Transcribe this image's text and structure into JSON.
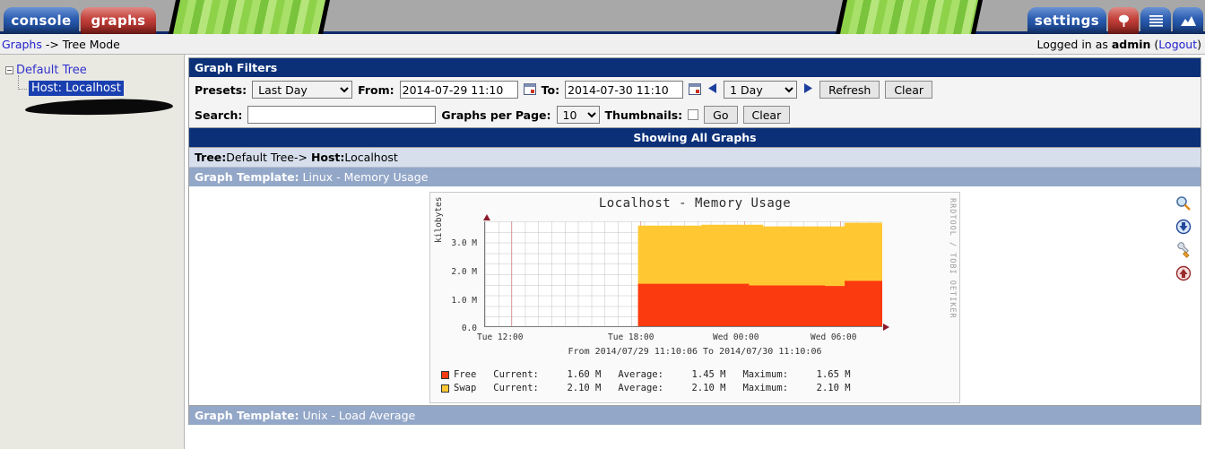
{
  "header": {
    "tabs": [
      {
        "label": "console",
        "name": "tab-console"
      },
      {
        "label": "graphs",
        "name": "tab-graphs"
      },
      {
        "label": "settings",
        "name": "tab-settings"
      }
    ],
    "icon_buttons": [
      "tree-icon",
      "list-icon",
      "graph-view-icon"
    ],
    "colors": {
      "tab_blue": "#2a5cb0",
      "tab_red": "#c4403a",
      "banner_green": "#8ed24a",
      "navy": "#102a6b"
    }
  },
  "breadcrumb": {
    "link": "Graphs",
    "rest": " -> Tree Mode",
    "logged_prefix": "Logged in as ",
    "user": "admin",
    "logout_open": " (",
    "logout": "Logout",
    "logout_close": ")"
  },
  "sidebar": {
    "root_label": "Default Tree",
    "expander_glyph": "−",
    "child_label": "Host: Localhost",
    "redacted_present": true
  },
  "filters": {
    "title": "Graph Filters",
    "presets_label": "Presets:",
    "presets_value": "Last Day",
    "presets_options": [
      "Last Day"
    ],
    "from_label": "From:",
    "from_value": "2014-07-29 11:10",
    "to_label": "To:",
    "to_value": "2014-07-30 11:10",
    "span_value": "1 Day",
    "span_options": [
      "1 Day"
    ],
    "refresh_label": "Refresh",
    "clear_label": "Clear",
    "search_label": "Search:",
    "search_value": "",
    "search_placeholder": "",
    "graphs_per_page_label": "Graphs per Page:",
    "graphs_per_page_value": "10",
    "graphs_per_page_options": [
      "10"
    ],
    "thumbnails_label": "Thumbnails:",
    "thumbnails_checked": false,
    "go_label": "Go",
    "clear2_label": "Clear"
  },
  "results": {
    "showing": "Showing All Graphs",
    "tree_label": "Tree:",
    "tree_value": "Default Tree-> ",
    "host_label": "Host:",
    "host_value": "Localhost",
    "template_label": "Graph Template:",
    "template_value": " Linux - Memory Usage",
    "template_bottom_label": "Graph Template:",
    "template_bottom_value": " Unix - Load Average"
  },
  "graph_actions": [
    {
      "name": "zoom-graph-icon",
      "title": "Zoom Graph"
    },
    {
      "name": "csv-export-icon",
      "title": "CSV Export"
    },
    {
      "name": "graph-properties-icon",
      "title": "Graph Properties"
    },
    {
      "name": "page-top-icon",
      "title": "Page Top"
    }
  ],
  "chart_data": {
    "type": "area",
    "title": "Localhost - Memory Usage",
    "ylabel": "kilobytes",
    "xlabel": "",
    "subtitle": "From 2014/07/29 11:10:06 To 2014/07/30 11:10:06",
    "watermark": "RRDTOOL / TOBI OETIKER",
    "ylim": [
      0,
      3700000
    ],
    "yticks": [
      "0.0",
      "1.0 M",
      "2.0 M",
      "3.0 M"
    ],
    "ytick_values": [
      0,
      1000000,
      2000000,
      3000000
    ],
    "xticks": [
      "Tue 12:00",
      "Tue 18:00",
      "Wed 00:00",
      "Wed 06:00"
    ],
    "xtick_positions": [
      0.07,
      0.39,
      0.65,
      0.89
    ],
    "stacked": true,
    "grid": true,
    "legend_position": "bottom",
    "series": [
      {
        "name": "Free",
        "color": "#fc3a10",
        "current": "1.60 M",
        "average": "1.45 M",
        "maximum": "1.65 M",
        "points": [
          [
            0.0,
            0
          ],
          [
            0.385,
            0
          ],
          [
            0.385,
            1500000
          ],
          [
            0.665,
            1500000
          ],
          [
            0.665,
            1440000
          ],
          [
            0.855,
            1440000
          ],
          [
            0.855,
            1420000
          ],
          [
            0.905,
            1420000
          ],
          [
            0.905,
            1600000
          ],
          [
            1.0,
            1600000
          ]
        ]
      },
      {
        "name": "Swap",
        "color": "#ffc832",
        "current": "2.10 M",
        "average": "2.10 M",
        "maximum": "2.10 M",
        "points": [
          [
            0.0,
            0
          ],
          [
            0.385,
            0
          ],
          [
            0.385,
            3550000
          ],
          [
            0.545,
            3550000
          ],
          [
            0.545,
            3580000
          ],
          [
            0.7,
            3580000
          ],
          [
            0.7,
            3520000
          ],
          [
            0.905,
            3520000
          ],
          [
            0.905,
            3650000
          ],
          [
            1.0,
            3650000
          ]
        ]
      }
    ],
    "legend_columns": [
      "Current:",
      "Average:",
      "Maximum:"
    ]
  }
}
